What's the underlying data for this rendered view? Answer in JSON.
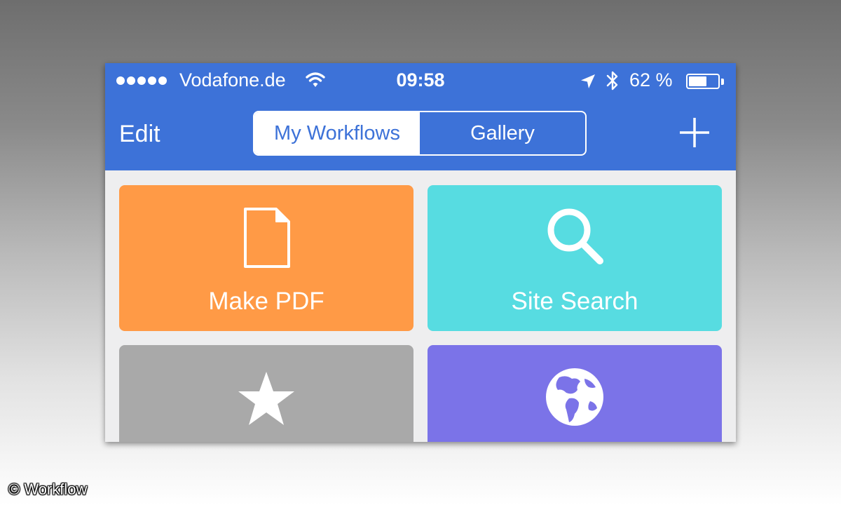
{
  "status_bar": {
    "carrier": "Vodafone.de",
    "time": "09:58",
    "battery_percent": "62 %",
    "battery_level": 0.62,
    "signal_bars": 5,
    "icons": [
      "signal-dots-icon",
      "wifi-icon",
      "location-arrow-icon",
      "bluetooth-icon",
      "battery-icon"
    ]
  },
  "nav": {
    "edit_label": "Edit",
    "segments": [
      {
        "label": "My Workflows",
        "selected": true
      },
      {
        "label": "Gallery",
        "selected": false
      }
    ],
    "add_icon": "plus-icon"
  },
  "workflows": [
    {
      "label": "Make PDF",
      "icon": "document-icon",
      "color": "#ff9a46"
    },
    {
      "label": "Site Search",
      "icon": "search-icon",
      "color": "#57dce1"
    },
    {
      "label": "",
      "icon": "star-icon",
      "color": "#a9a9a9"
    },
    {
      "label": "",
      "icon": "globe-icon",
      "color": "#7b73e8"
    }
  ],
  "colors": {
    "nav_bar": "#3d72d8",
    "content_background": "#eeeeef"
  },
  "credit": "© Workflow"
}
